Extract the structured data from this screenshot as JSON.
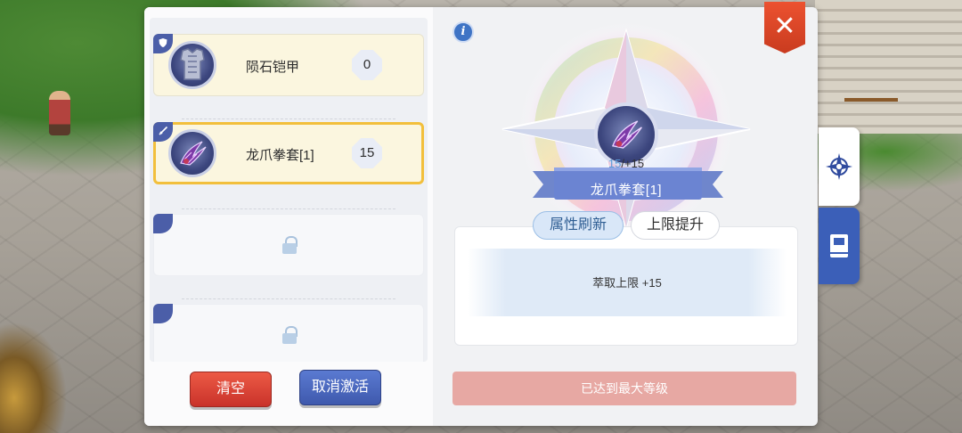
{
  "slots": [
    {
      "name": "陨石铠甲",
      "value": "0",
      "icon": "armor-icon",
      "tag": "shield"
    },
    {
      "name": "龙爪拳套[1]",
      "value": "15",
      "icon": "claw-icon",
      "tag": "sword",
      "selected": true
    },
    {
      "locked": true
    },
    {
      "locked": true
    }
  ],
  "buttons": {
    "clear_label": "清空",
    "cancel_label": "取消激活"
  },
  "detail": {
    "info_icon": "i",
    "level_current": "15",
    "level_bonus": "/+15",
    "item_name": "龙爪拳套[1]",
    "tabs": {
      "refresh": "属性刷新",
      "upgrade": "上限提升"
    },
    "active_tab": "refresh",
    "effect_line": "萃取上限 +15",
    "max_level_text": "已达到最大等级"
  },
  "close_label": "✕",
  "side_tabs": [
    {
      "icon": "compass-icon"
    },
    {
      "icon": "book-icon"
    }
  ],
  "colors": {
    "accent_blue": "#3f59ad",
    "danger_red": "#c9322a",
    "selected_border": "#f2bf3c",
    "max_bar": "#e7a8a3"
  }
}
